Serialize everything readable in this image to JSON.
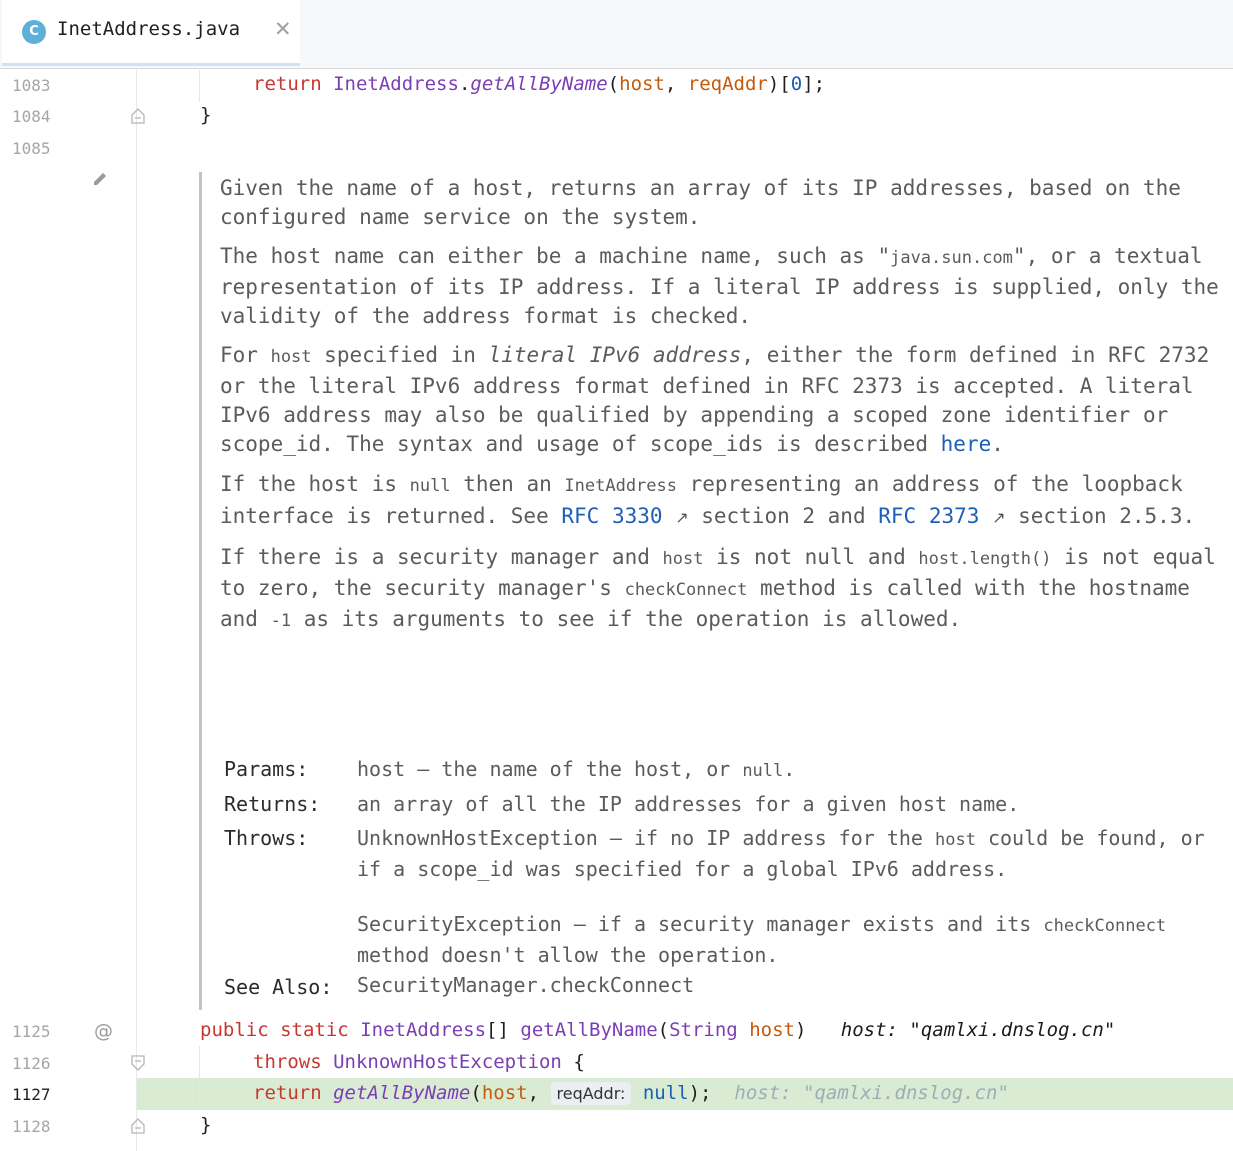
{
  "tab": {
    "icon_letter": "C",
    "label": "InetAddress.java",
    "close_glyph": "✕"
  },
  "line_numbers": {
    "l1083": "1083",
    "l1084": "1084",
    "l1085": "1085",
    "l1125": "1125",
    "l1126": "1126",
    "l1127": "1127",
    "l1128": "1128"
  },
  "gutter": {
    "at_marker": "@"
  },
  "code": {
    "l1083": {
      "kw": "return",
      "cls": "InetAddress",
      "dot": ".",
      "method": "getAllByName",
      "open": "(",
      "arg1": "host",
      "comma": ", ",
      "arg2": "reqAddr",
      "close": ")[",
      "index": "0",
      "end": "];"
    },
    "l1084": "}",
    "l1125": {
      "mod1": "public",
      "mod2": "static",
      "type": "InetAddress",
      "arr": "[]",
      "method": "getAllByName",
      "open": "(",
      "ptype": "String",
      "param": "host",
      "close": ")",
      "debug": "host: \"qamlxi.dnslog.cn\""
    },
    "l1126": {
      "kw": "throws",
      "exc": "UnknownHostException",
      "brace": "{"
    },
    "l1127": {
      "kw": "return",
      "method": "getAllByName",
      "open": "(",
      "arg1": "host",
      "comma": ",",
      "hint": "reqAddr:",
      "null": "null",
      "end": ");",
      "debug": "host: \"qamlxi.dnslog.cn\""
    },
    "l1128": "}"
  },
  "doc": {
    "p1": "Given the name of a host, returns an array of its IP addresses, based on the configured name service on the system.",
    "p2a": "The host name can either be a machine name, such as \"",
    "p2code": "java.sun.com",
    "p2b": "\", or a textual representation of its IP address. If a literal IP address is supplied, only the validity of the address format is checked.",
    "p3a": "For ",
    "p3code": "host",
    "p3b": " specified in ",
    "p3em": "literal IPv6 address",
    "p3c": ", either the form defined in RFC 2732 or the literal IPv6 address format defined in RFC 2373 is accepted. A literal IPv6 address may also be qualified by appending a scoped zone identifier or scope_id. The syntax and usage of scope_ids is described ",
    "p3link": "here",
    "p3d": ".",
    "p4a": "If the host is ",
    "p4null": "null",
    "p4b": " then an ",
    "p4code": "InetAddress",
    "p4c": " representing an address of the loopback interface is returned. See ",
    "p4link1": "RFC 3330",
    "p4d": " section 2 and ",
    "p4link2": "RFC 2373",
    "p4e": " section 2.5.3.",
    "arrow": "↗",
    "p5a": "If there is a security manager and ",
    "p5code1": "host",
    "p5b": " is not null and ",
    "p5code2": "host.length()",
    "p5c": " is not equal to zero, the security manager's ",
    "p5code3": "checkConnect",
    "p5d": " method is called with the hostname and ",
    "p5code4": "-1",
    "p5e": " as its arguments to see if the operation is allowed.",
    "params_label": "Params:",
    "params_a": "host – the name of the host, or ",
    "params_null": "null",
    "params_b": ".",
    "returns_label": "Returns:",
    "returns_text": "an array of all the IP addresses for a given host name.",
    "throws_label": "Throws:",
    "throws1_link": "UnknownHostException",
    "throws1_a": " – if no IP address for the ",
    "throws1_code": "host",
    "throws1_b": " could be found, or if a scope_id was specified for a global IPv6 address.",
    "throws2_link": "SecurityException",
    "throws2_a": " – if a security manager exists and its ",
    "throws2_code": "checkConnect",
    "throws2_b": " method doesn't allow the operation.",
    "see_label": "See Also:",
    "see_link": "SecurityManager.checkConnect"
  }
}
